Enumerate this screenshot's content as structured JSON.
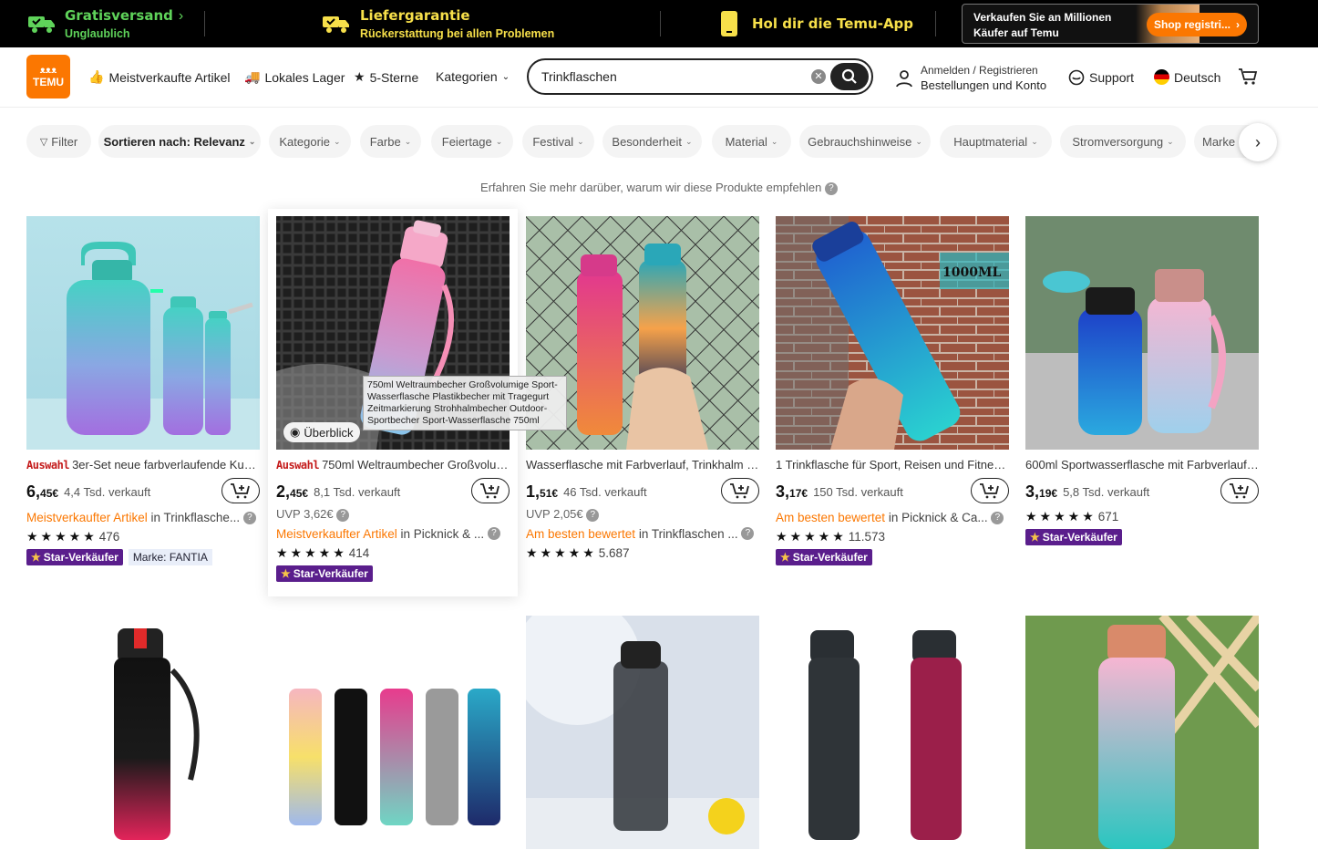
{
  "promo": {
    "shipping_title": "Gratisversand",
    "shipping_sub": "Unglaublich",
    "guarantee_title": "Liefergarantie",
    "guarantee_sub": "Rückerstattung bei allen Problemen",
    "app_title": "Hol dir die Temu-App",
    "seller_line1": "Verkaufen Sie an Millionen",
    "seller_line2": "Käufer auf Temu",
    "seller_button": "Shop registri..."
  },
  "header": {
    "logo_line1": "ᴥᴥᴥ",
    "logo_line2": "TEMU",
    "nav": [
      "Meistverkaufte Artikel",
      "Lokales Lager",
      "5-Sterne",
      "Kategorien"
    ],
    "search_value": "Trinkflaschen",
    "account_line1": "Anmelden / Registrieren",
    "account_line2": "Bestellungen und Konto",
    "support": "Support",
    "language": "Deutsch"
  },
  "filters": [
    "Filter",
    "Sortieren nach: Relevanz",
    "Kategorie",
    "Farbe",
    "Feiertage",
    "Festival",
    "Besonderheit",
    "Material",
    "Gebrauchshinweise",
    "Hauptmaterial",
    "Stromversorgung",
    "Marke"
  ],
  "recommend_text": "Erfahren Sie mehr darüber, warum wir diese Produkte empfehlen",
  "products": [
    {
      "auswahl": "Auswahl",
      "title": "3er-Set neue farbverlaufende Kuns...",
      "price_int": "6,",
      "price_dec": "45",
      "currency": "€",
      "sold": "4,4 Tsd. verkauft",
      "uvp": "",
      "rank_hl": "Meistverkaufter Artikel",
      "rank_rest": " in Trinkflasche...",
      "rating": "476",
      "stars": "★★★★★",
      "star_seller": "Star-Verkäufer",
      "brand": "Marke: FANTIA"
    },
    {
      "auswahl": "Auswahl",
      "title": "750ml Weltraumbecher Großvolum...",
      "price_int": "2,",
      "price_dec": "45",
      "currency": "€",
      "sold": "8,1 Tsd. verkauft",
      "uvp": "UVP 3,62€",
      "rank_hl": "Meistverkaufter Artikel",
      "rank_rest": " in Picknick & ...",
      "rating": "414",
      "stars": "★★★★★",
      "star_seller": "Star-Verkäufer",
      "brand": ""
    },
    {
      "auswahl": "",
      "title": "Wasserflasche mit Farbverlauf, Trinkhalm u...",
      "price_int": "1,",
      "price_dec": "51",
      "currency": "€",
      "sold": "46 Tsd. verkauft",
      "uvp": "UVP 2,05€",
      "rank_hl": "Am besten bewertet",
      "rank_rest": " in Trinkflaschen ...",
      "rating": "5.687",
      "stars": "★★★★★",
      "star_seller": "",
      "brand": ""
    },
    {
      "auswahl": "",
      "title": "1 Trinkflasche für Sport, Reisen und Fitness,...",
      "price_int": "3,",
      "price_dec": "17",
      "currency": "€",
      "sold": "150 Tsd. verkauft",
      "uvp": "",
      "rank_hl": "Am besten bewertet",
      "rank_rest": " in Picknick & Ca...",
      "rating": "11.573",
      "stars": "★★★★★",
      "star_seller": "Star-Verkäufer",
      "brand": ""
    },
    {
      "auswahl": "",
      "title": "600ml Sportwasserflasche mit Farbverlauf ...",
      "price_int": "3,",
      "price_dec": "19",
      "currency": "€",
      "sold": "5,8 Tsd. verkauft",
      "uvp": "",
      "rank_hl": "",
      "rank_rest": "",
      "rating": "671",
      "stars": "★★★★★",
      "star_seller": "Star-Verkäufer",
      "brand": ""
    }
  ],
  "tooltip": "750ml Weltraumbecher Großvolumige Sport-Wasserflasche Plastikbecher mit Tragegurt Zeitmarkierung Strohhalmbecher Outdoor-Sportbecher Sport-Wasserflasche 750ml",
  "overview": "Überblick",
  "image_labels": {
    "p4_label": "1000ML"
  },
  "colors": {
    "accent": "#fb7701",
    "star_badge": "#5a1e8c",
    "promo_yellow": "#f7e04a",
    "promo_green": "#5fd35a"
  }
}
